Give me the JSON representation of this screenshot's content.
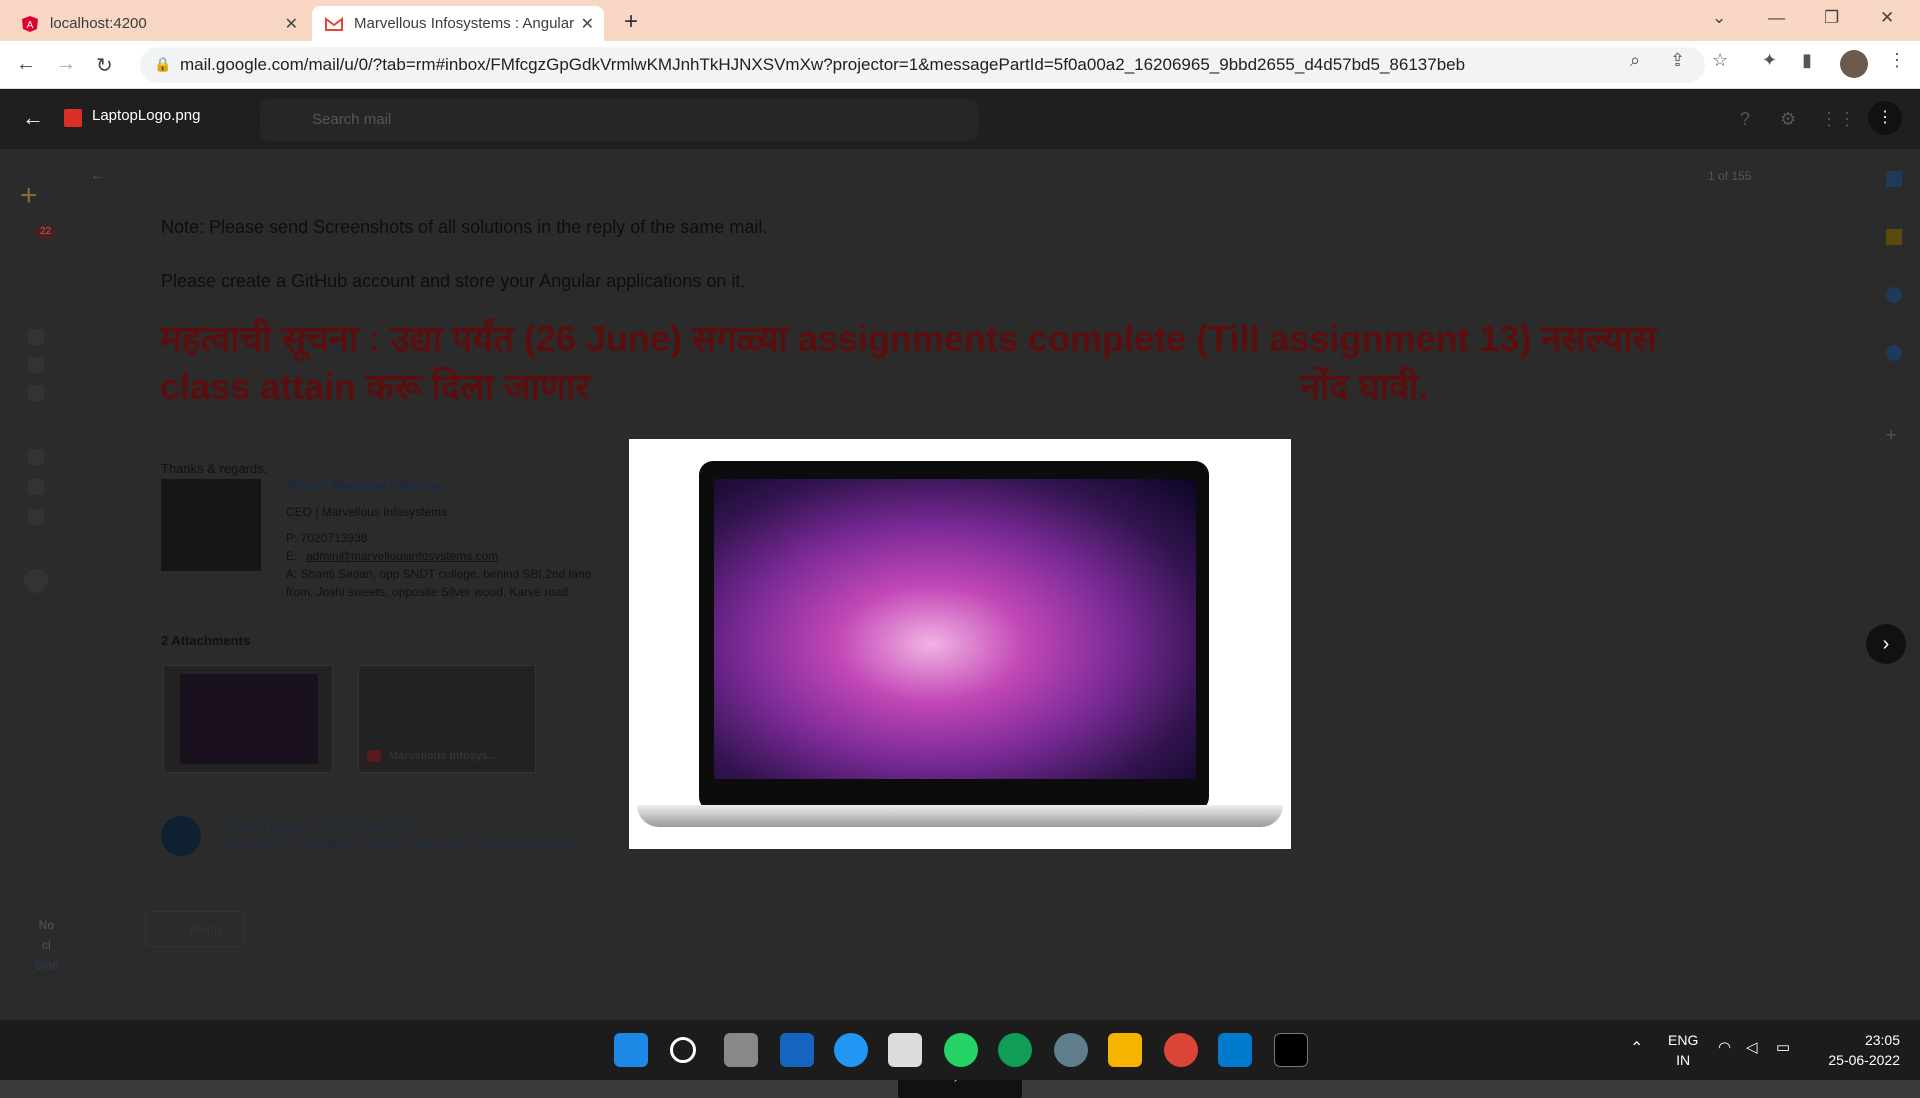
{
  "browser": {
    "tabs": [
      {
        "title": "localhost:4200",
        "icon": "angular-icon"
      },
      {
        "title": "Marvellous Infosystems : Angular",
        "icon": "gmail-icon"
      }
    ],
    "url": "mail.google.com/mail/u/0/?tab=rm#inbox/FMfcgzGpGdkVrmlwKMJnhTkHJNXSVmXw?projector=1&messagePartId=5f0a00a2_16206965_9bbd2655_d4d57bd5_86137beb"
  },
  "viewer": {
    "filename": "LaptopLogo.png",
    "search_placeholder": "Search mail",
    "counter": "1 of 155"
  },
  "email": {
    "note1": "Note: Please send Screenshots of all solutions in the reply of the same mail.",
    "note2": "Please create a GitHub account and store your Angular applications on it.",
    "marathi_line1": "महत्वाची सूचना : उद्या पर्यंत (26 June) सगळ्या assignments complete (Till assignment 13) नसल्यास",
    "marathi_line2_start": "class attain करू दिला जाणार",
    "marathi_line2_end": "नोंद घावी.",
    "signature": {
      "regards": "Thanks & regards,",
      "name": "Piyush Manohar Khairnar",
      "title": "CEO | Marvellous Infosystems",
      "phone": "P:  7020713938",
      "email": "admin@marvellousinfosystems.com",
      "email_prefix": "E:",
      "address1": "A: Shanti Sadan, opp SNDT college, behind SBI,2nd lane",
      "address2": "from, Joshi sweets, opposite Silver wood, Karve road"
    },
    "attachments_label": "2 Attachments",
    "attachment_pdf": "Marvellous Infosys...",
    "expiry": "Content expires on 23 Sept 2022.",
    "expiry_note": "You do not have the option to forward, copy, print or download this email.",
    "reply": "Reply",
    "inbox_badge": "22"
  },
  "sidebar_text": {
    "l1": "No",
    "l2": "cl",
    "l3": "Stan"
  },
  "taskbar": {
    "lang1": "ENG",
    "lang2": "IN",
    "time": "23:05",
    "date": "25-06-2022"
  }
}
